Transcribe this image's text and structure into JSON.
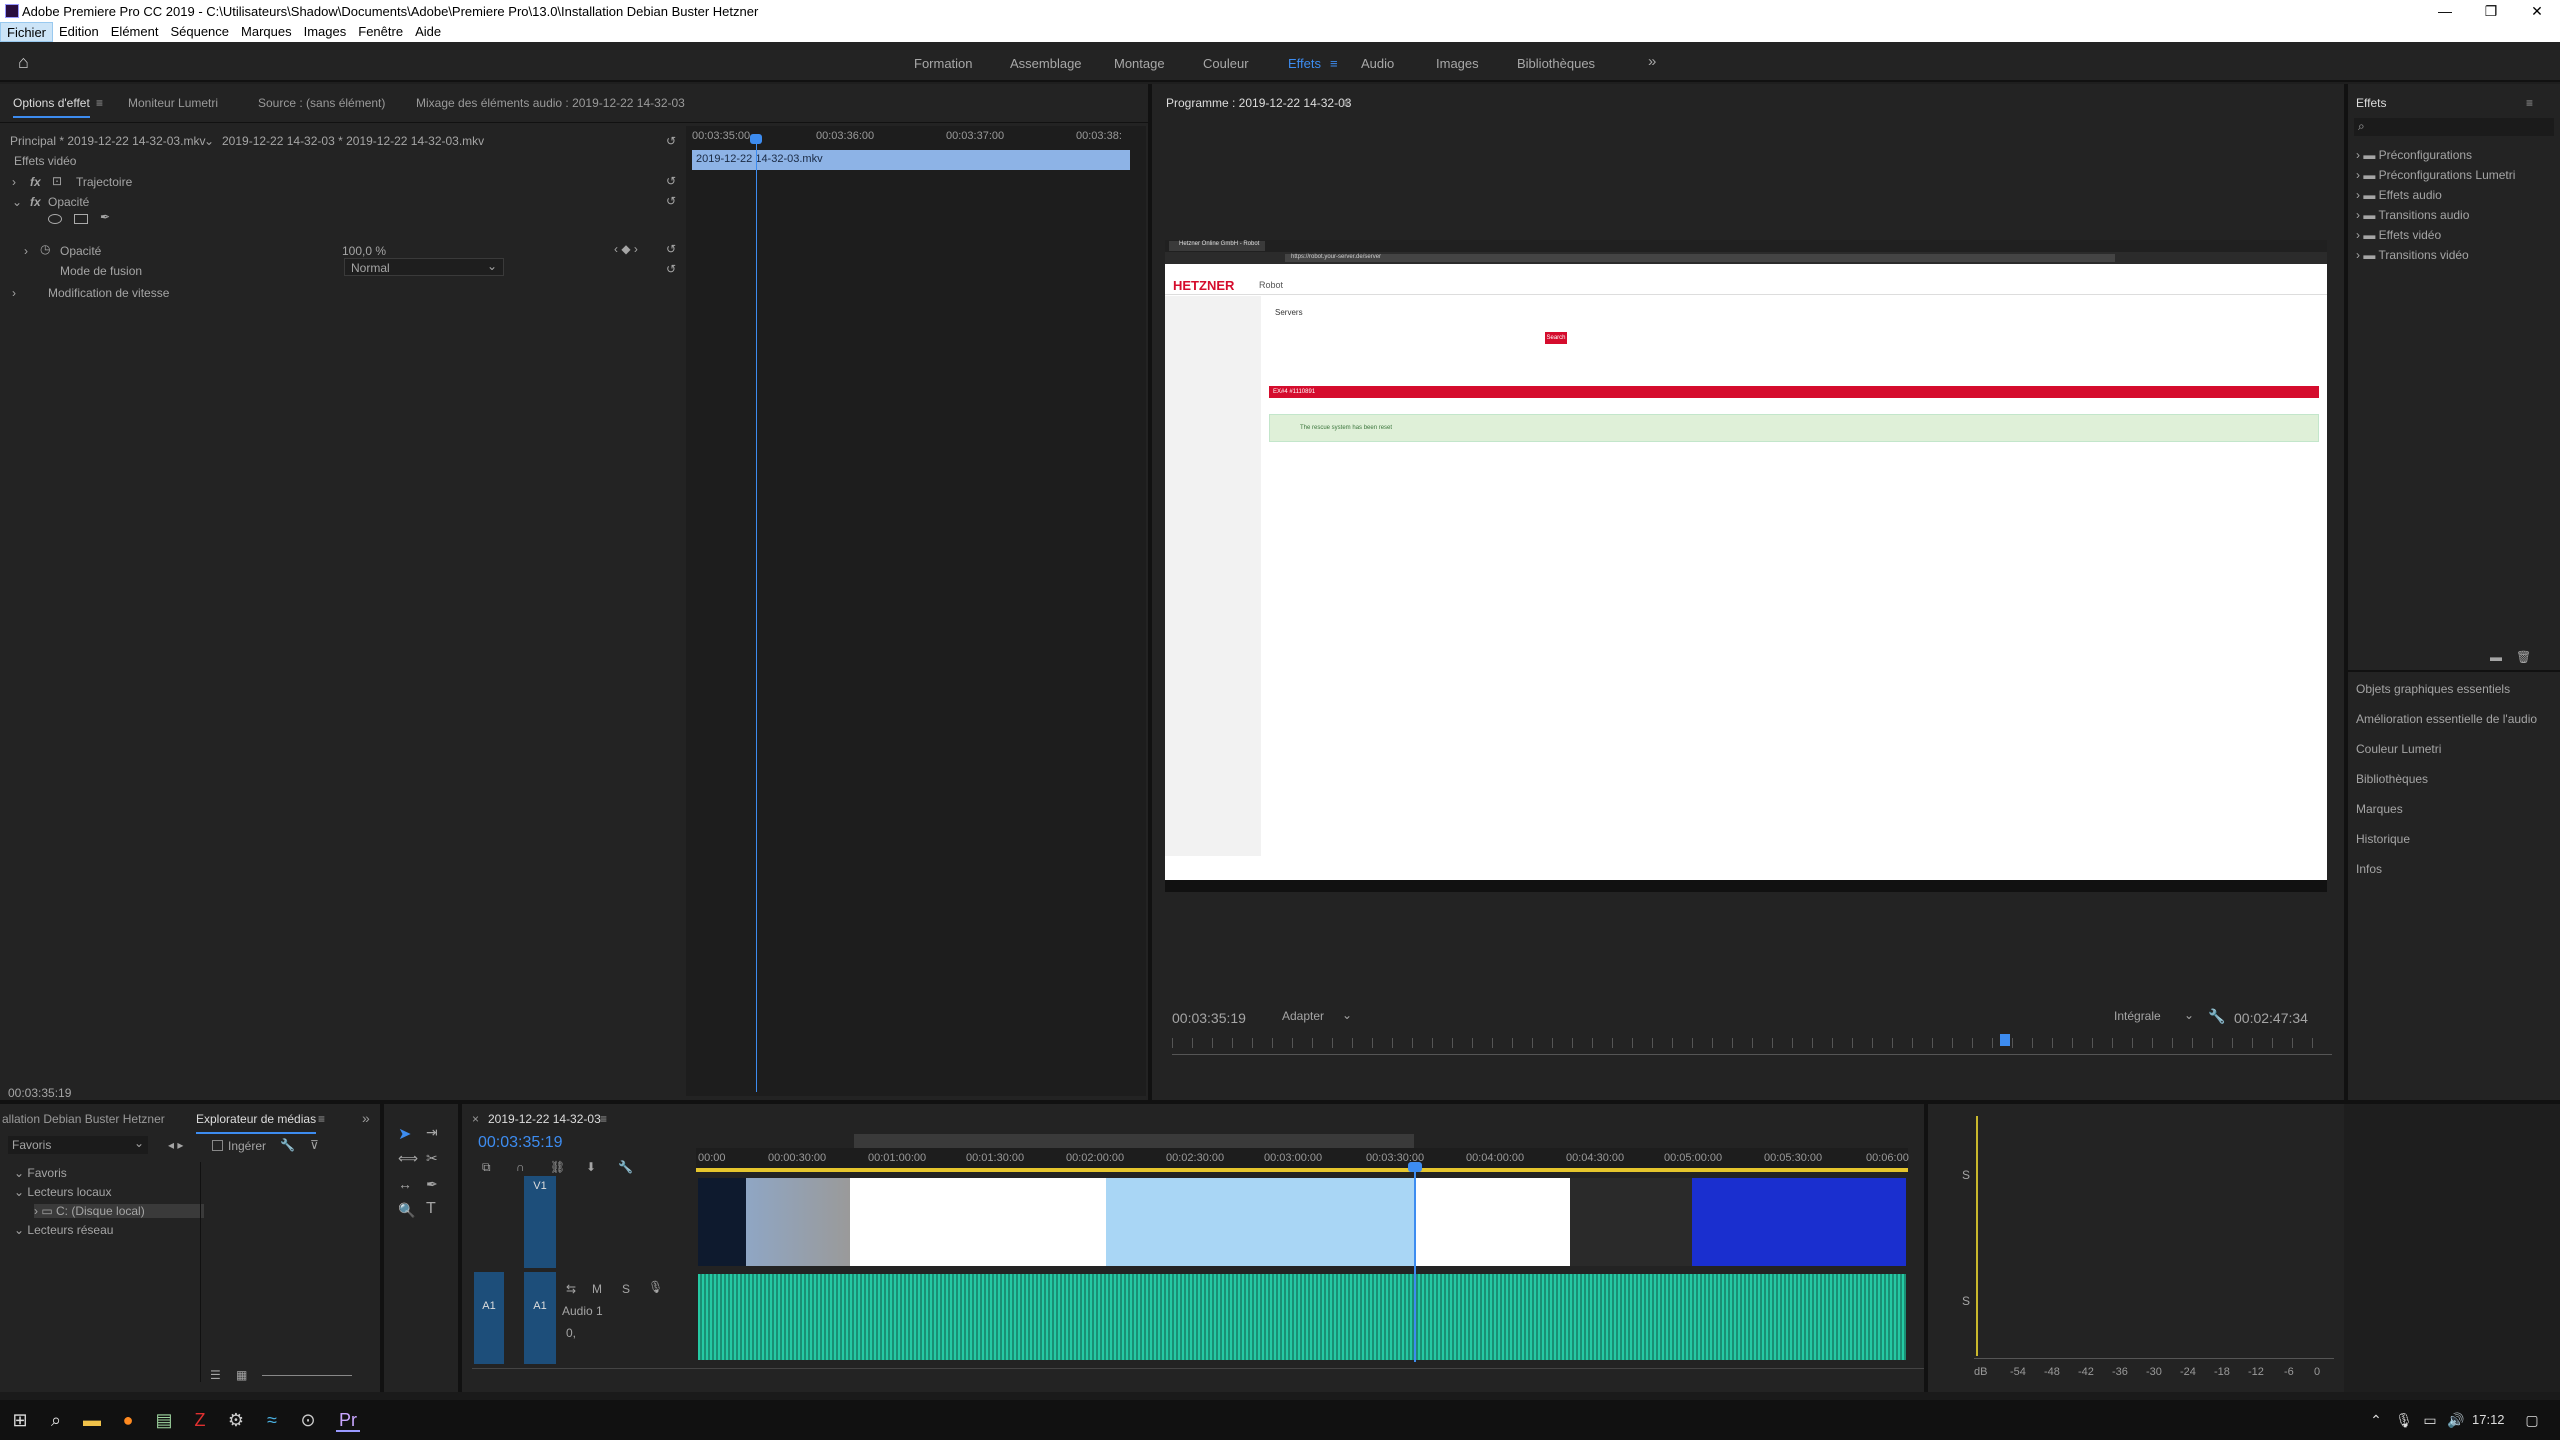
{
  "window": {
    "title": "Adobe Premiere Pro CC 2019 - C:\\Utilisateurs\\Shadow\\Documents\\Adobe\\Premiere Pro\\13.0\\Installation Debian Buster Hetzner",
    "minimize": "—",
    "maximize": "❐",
    "close": "✕"
  },
  "menu": [
    "Fichier",
    "Edition",
    "Elément",
    "Séquence",
    "Marques",
    "Images",
    "Fenêtre",
    "Aide"
  ],
  "workspaces": [
    "Formation",
    "Assemblage",
    "Montage",
    "Couleur",
    "Effets",
    "Audio",
    "Images",
    "Bibliothèques"
  ],
  "workspace_active": "Effets",
  "workspace_more": "»",
  "effect_panel": {
    "tabs": [
      "Options d'effet",
      "Moniteur Lumetri",
      "Source : (sans élément)",
      "Mixage des éléments audio : 2019-12-22 14-32-03"
    ],
    "master": "Principal * 2019-12-22 14-32-03.mkv",
    "clip": "2019-12-22 14-32-03 * 2019-12-22 14-32-03.mkv",
    "section": "Effets vidéo",
    "fx1": "Trajectoire",
    "fx2": "Opacité",
    "opacity_label": "Opacité",
    "opacity_value": "100,0 %",
    "blend_label": "Mode de fusion",
    "blend_value": "Normal",
    "speed": "Modification de vitesse",
    "ruler": [
      "00:03:35:00",
      "00:03:36:00",
      "00:03:37:00",
      "00:03:38:"
    ],
    "clipbar": "2019-12-22 14-32-03.mkv",
    "timecode": "00:03:35:19"
  },
  "program": {
    "title": "Programme : 2019-12-22 14-32-03",
    "timecode": "00:03:35:19",
    "fit": "Adapter",
    "quality": "Intégrale",
    "duration": "00:02:47:34",
    "screen": {
      "browser_tab": "Hetzner Online GmbH - Robot",
      "url": "https://robot.your-server.de/server",
      "brand": "HETZNER",
      "brand_sub": "Robot",
      "page_title": "Servers",
      "search_btn": "Search",
      "server_id": "EX#4 #1110891",
      "success_msg": "The rescue system has been reset"
    }
  },
  "effects": {
    "title": "Effets",
    "items": [
      "Préconfigurations",
      "Préconfigurations Lumetri",
      "Effets audio",
      "Transitions audio",
      "Effets vidéo",
      "Transitions vidéo"
    ],
    "side": [
      "Objets graphiques essentiels",
      "Amélioration essentielle de l'audio",
      "Couleur Lumetri",
      "Bibliothèques",
      "Marques",
      "Historique",
      "Infos"
    ]
  },
  "project": {
    "tabs": [
      "allation Debian Buster Hetzner",
      "Explorateur de médias"
    ],
    "favorites": "Favoris",
    "ingest": "Ingérer",
    "tree": [
      "Favoris",
      "Lecteurs locaux",
      "C: (Disque local)",
      "Lecteurs réseau"
    ]
  },
  "timeline": {
    "seq": "2019-12-22 14-32-03",
    "timecode": "00:03:35:19",
    "ruler": [
      "00:00",
      "00:00:30:00",
      "00:01:00:00",
      "00:01:30:00",
      "00:02:00:00",
      "00:02:30:00",
      "00:03:00:00",
      "00:03:30:00",
      "00:04:00:00",
      "00:04:30:00",
      "00:05:00:00",
      "00:05:30:00",
      "00:06:00"
    ],
    "v1": "V1",
    "a1": "A1",
    "audio1": "Audio 1",
    "m": "M",
    "s": "S",
    "vol": "0,"
  },
  "meter": {
    "ticks": [
      "dB",
      "-54",
      "-48",
      "-42",
      "-36",
      "-30",
      "-24",
      "-18",
      "-12",
      "-6",
      "0"
    ],
    "s": "S"
  },
  "taskbar": {
    "time": "17:12"
  }
}
